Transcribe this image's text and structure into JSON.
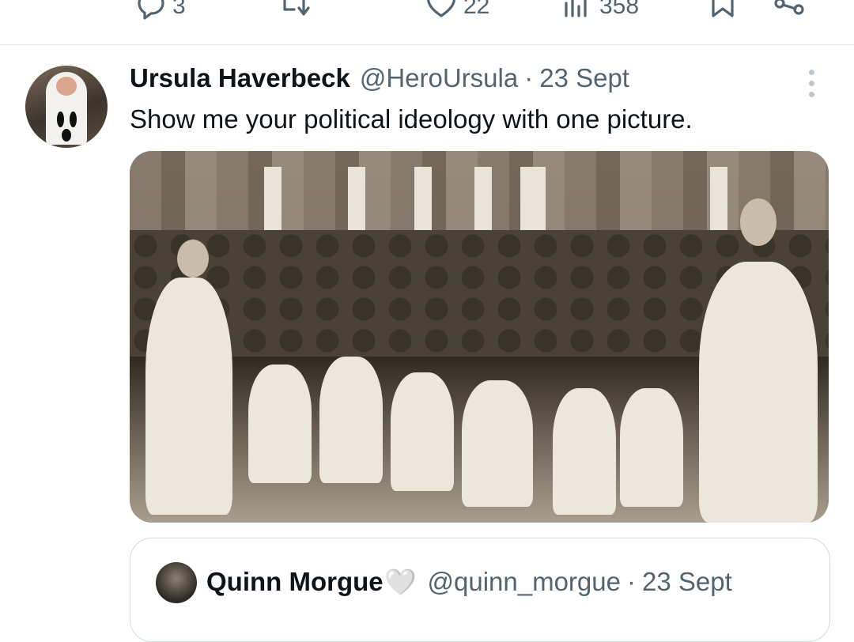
{
  "actions": {
    "reply": {
      "icon": "reply-icon",
      "count": "3"
    },
    "retweet": {
      "icon": "retweet-icon"
    },
    "like": {
      "icon": "heart-icon",
      "count": "22"
    },
    "views": {
      "icon": "views-icon",
      "count": "358"
    },
    "bookmark": {
      "icon": "bookmark-icon"
    },
    "share": {
      "icon": "share-icon"
    }
  },
  "tweet": {
    "name": "Ursula Haverbeck",
    "handle": "@HeroUrsula",
    "separator": "·",
    "date": "23 Sept",
    "text": "Show me your political ideology with one picture."
  },
  "quote": {
    "name": "Quinn Morgue",
    "emoji": "🤍",
    "handle": "@quinn_morgue",
    "separator": "·",
    "date": "23 Sept"
  },
  "colors": {
    "text": "#0f1419",
    "secondary": "#536471",
    "border": "#cfd9de"
  }
}
